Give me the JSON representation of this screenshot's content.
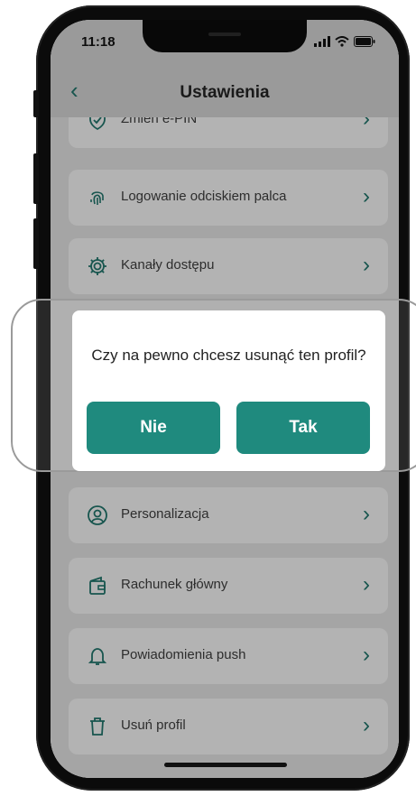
{
  "status_bar": {
    "time": "11:18"
  },
  "header": {
    "back_icon": "‹",
    "title": "Ustawienia"
  },
  "settings": {
    "items": [
      {
        "label": "Zmień e-PIN",
        "icon": "shield-check-icon"
      },
      {
        "label": "Logowanie odciskiem palca",
        "icon": "fingerprint-icon"
      },
      {
        "label": "Kanały dostępu",
        "icon": "gear-icon"
      },
      {
        "label": "Personalizacja",
        "icon": "user-icon"
      },
      {
        "label": "Rachunek główny",
        "icon": "wallet-icon"
      },
      {
        "label": "Powiadomienia push",
        "icon": "bell-icon"
      },
      {
        "label": "Usuń profil",
        "icon": "trash-icon"
      }
    ],
    "chevron": "›"
  },
  "dialog": {
    "question": "Czy na pewno chcesz usunąć ten profil?",
    "no_label": "Nie",
    "yes_label": "Tak"
  },
  "colors": {
    "accent": "#1f8a7e",
    "icon": "#1e6e64",
    "text": "#222222"
  }
}
